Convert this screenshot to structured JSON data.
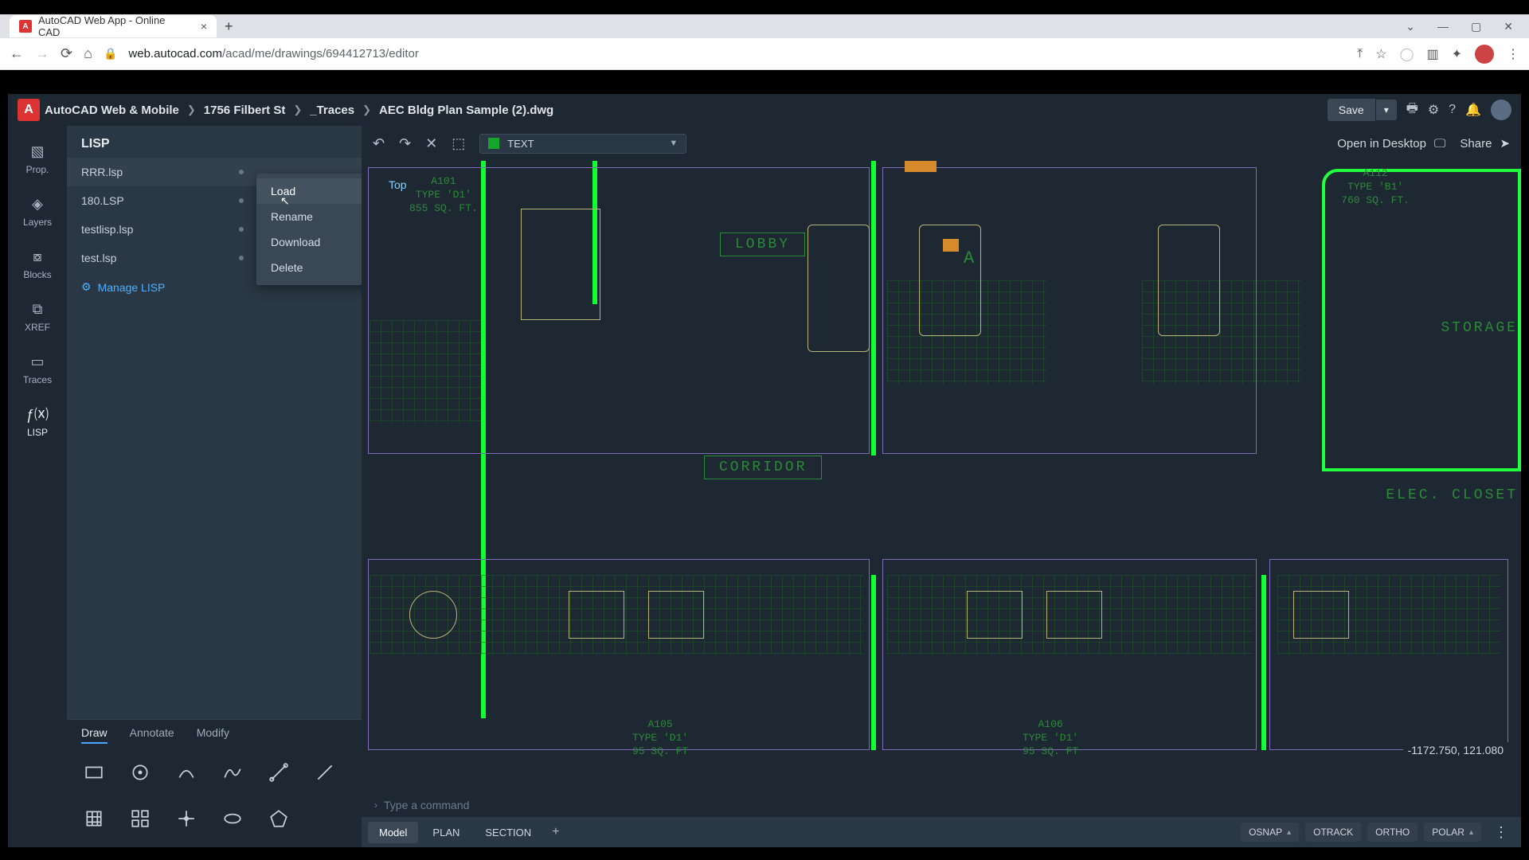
{
  "browser": {
    "tab_title": "AutoCAD Web App - Online CAD",
    "url_host": "web.autocad.com",
    "url_path": "/acad/me/drawings/694412713/editor"
  },
  "header": {
    "brand": "AutoCAD Web & Mobile",
    "crumb1": "1756 Filbert St",
    "crumb2": "_Traces",
    "crumb3": "AEC Bldg Plan Sample (2).dwg",
    "save": "Save",
    "open_desktop": "Open in Desktop",
    "share": "Share"
  },
  "rail": {
    "items": [
      {
        "label": "Prop."
      },
      {
        "label": "Layers"
      },
      {
        "label": "Blocks"
      },
      {
        "label": "XREF"
      },
      {
        "label": "Traces"
      },
      {
        "label": "LISP"
      }
    ]
  },
  "panel": {
    "title": "LISP",
    "files": [
      {
        "name": "RRR.lsp"
      },
      {
        "name": "180.LSP"
      },
      {
        "name": "testlisp.lsp"
      },
      {
        "name": "test.lsp"
      }
    ],
    "manage": "Manage LISP"
  },
  "context_menu": {
    "items": [
      "Load",
      "Rename",
      "Download",
      "Delete"
    ],
    "highlighted": 0
  },
  "toolbar": {
    "layer_name": "TEXT",
    "view_badge": "Top"
  },
  "draw_tools": {
    "tabs": [
      "Draw",
      "Annotate",
      "Modify"
    ],
    "active": 0
  },
  "canvas": {
    "coord": "-1172.750, 121.080",
    "labels": {
      "lobby": "LOBBY",
      "corridor": "CORRIDOR",
      "storage": "STORAGE",
      "elec": "ELEC. CLOSET",
      "a": "A"
    },
    "rooms": {
      "a101": "A101\nTYPE 'D1'\n855 SQ. FT.",
      "a112": "A112\nTYPE 'B1'\n760 SQ. FT.",
      "a105": "A105\nTYPE 'D1'\n95 SQ. FT",
      "a106": "A106\nTYPE 'D1'\n95 SQ. FT"
    }
  },
  "command": {
    "placeholder": "Type a command"
  },
  "layout_tabs": {
    "tabs": [
      "Model",
      "PLAN",
      "SECTION"
    ],
    "active": 0
  },
  "snaps": {
    "osnap": "OSNAP",
    "otrack": "OTRACK",
    "ortho": "ORTHO",
    "polar": "POLAR"
  }
}
